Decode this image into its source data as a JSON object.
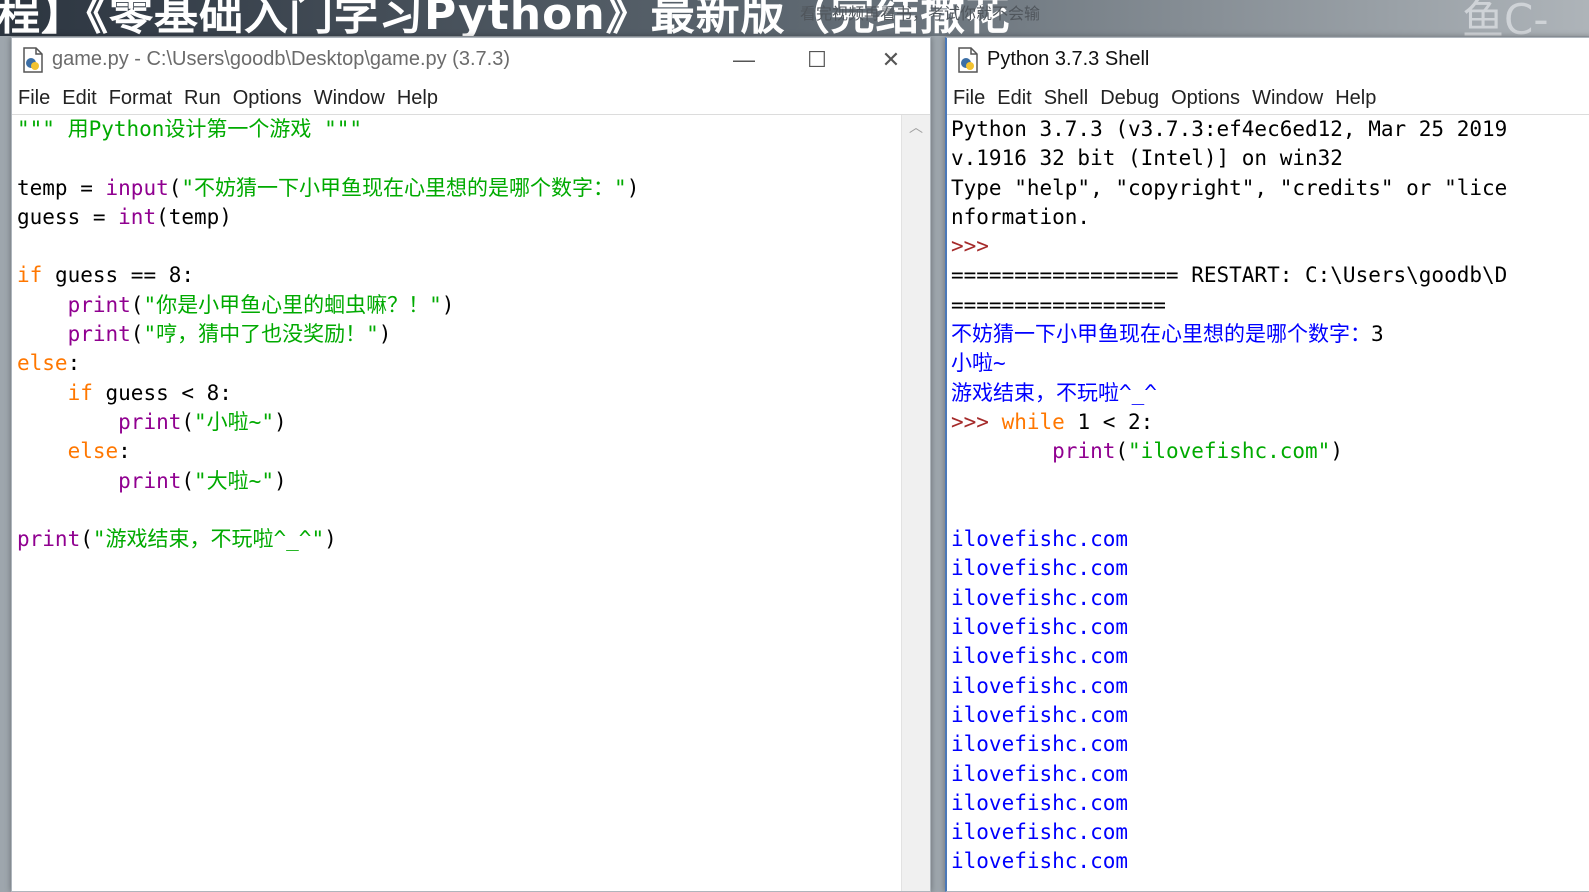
{
  "background": {
    "banner_text": "程】《零基础入门学习Python》最新版（完结撒花",
    "banner_subtitle": "看完视频再看书，考试你就不会输",
    "banner_logo": "鱼C-"
  },
  "editor": {
    "title": "game.py - C:\\Users\\goodb\\Desktop\\game.py (3.7.3)",
    "menu": [
      "File",
      "Edit",
      "Format",
      "Run",
      "Options",
      "Window",
      "Help"
    ],
    "lines": [
      [
        {
          "t": "\"\"\" 用Python设计第一个游戏 \"\"\"",
          "c": "str"
        }
      ],
      [],
      [
        {
          "t": "temp = ",
          "c": "def"
        },
        {
          "t": "input",
          "c": "bi"
        },
        {
          "t": "(",
          "c": "def"
        },
        {
          "t": "\"不妨猜一下小甲鱼现在心里想的是哪个数字：\"",
          "c": "str"
        },
        {
          "t": ")",
          "c": "def"
        }
      ],
      [
        {
          "t": "guess = ",
          "c": "def"
        },
        {
          "t": "int",
          "c": "bi"
        },
        {
          "t": "(temp)",
          "c": "def"
        }
      ],
      [],
      [
        {
          "t": "if",
          "c": "kw"
        },
        {
          "t": " guess == 8:",
          "c": "def"
        }
      ],
      [
        {
          "t": "    ",
          "c": "def"
        },
        {
          "t": "print",
          "c": "bi"
        },
        {
          "t": "(",
          "c": "def"
        },
        {
          "t": "\"你是小甲鱼心里的蛔虫嘛？！\"",
          "c": "str"
        },
        {
          "t": ")",
          "c": "def"
        }
      ],
      [
        {
          "t": "    ",
          "c": "def"
        },
        {
          "t": "print",
          "c": "bi"
        },
        {
          "t": "(",
          "c": "def"
        },
        {
          "t": "\"哼，猜中了也没奖励！\"",
          "c": "str"
        },
        {
          "t": ")",
          "c": "def"
        }
      ],
      [
        {
          "t": "else",
          "c": "kw"
        },
        {
          "t": ":",
          "c": "def"
        }
      ],
      [
        {
          "t": "    ",
          "c": "def"
        },
        {
          "t": "if",
          "c": "kw"
        },
        {
          "t": " guess < 8:",
          "c": "def"
        }
      ],
      [
        {
          "t": "        ",
          "c": "def"
        },
        {
          "t": "print",
          "c": "bi"
        },
        {
          "t": "(",
          "c": "def"
        },
        {
          "t": "\"小啦~\"",
          "c": "str"
        },
        {
          "t": ")",
          "c": "def"
        }
      ],
      [
        {
          "t": "    ",
          "c": "def"
        },
        {
          "t": "else",
          "c": "kw"
        },
        {
          "t": ":",
          "c": "def"
        }
      ],
      [
        {
          "t": "        ",
          "c": "def"
        },
        {
          "t": "print",
          "c": "bi"
        },
        {
          "t": "(",
          "c": "def"
        },
        {
          "t": "\"大啦~\"",
          "c": "str"
        },
        {
          "t": ")",
          "c": "def"
        }
      ],
      [],
      [
        {
          "t": "print",
          "c": "bi"
        },
        {
          "t": "(",
          "c": "def"
        },
        {
          "t": "\"游戏结束，不玩啦^_^\"",
          "c": "str"
        },
        {
          "t": ")",
          "c": "def"
        }
      ]
    ]
  },
  "shell": {
    "title": "Python 3.7.3 Shell",
    "menu": [
      "File",
      "Edit",
      "Shell",
      "Debug",
      "Options",
      "Window",
      "Help"
    ],
    "lines": [
      [
        {
          "t": "Python 3.7.3 (v3.7.3:ef4ec6ed12, Mar 25 2019",
          "c": "def"
        }
      ],
      [
        {
          "t": "v.1916 32 bit (Intel)] on win32",
          "c": "def"
        }
      ],
      [
        {
          "t": "Type \"help\", \"copyright\", \"credits\" or \"lice",
          "c": "def"
        }
      ],
      [
        {
          "t": "nformation.",
          "c": "def"
        }
      ],
      [
        {
          "t": ">>> ",
          "c": "prompt"
        }
      ],
      [
        {
          "t": "================== RESTART: C:\\Users\\goodb\\D",
          "c": "def"
        }
      ],
      [
        {
          "t": "=================",
          "c": "def"
        }
      ],
      [
        {
          "t": "不妨猜一下小甲鱼现在心里想的是哪个数字：",
          "c": "out"
        },
        {
          "t": "3",
          "c": "def"
        }
      ],
      [
        {
          "t": "小啦~",
          "c": "out"
        }
      ],
      [
        {
          "t": "游戏结束，不玩啦^_^",
          "c": "out"
        }
      ],
      [
        {
          "t": ">>> ",
          "c": "prompt"
        },
        {
          "t": "while",
          "c": "kw"
        },
        {
          "t": " 1 < 2:",
          "c": "def"
        }
      ],
      [
        {
          "t": "        ",
          "c": "def"
        },
        {
          "t": "print",
          "c": "bi"
        },
        {
          "t": "(",
          "c": "def"
        },
        {
          "t": "\"ilovefishc.com\"",
          "c": "str"
        },
        {
          "t": ")",
          "c": "def"
        }
      ],
      [],
      [],
      [
        {
          "t": "ilovefishc.com",
          "c": "out"
        }
      ],
      [
        {
          "t": "ilovefishc.com",
          "c": "out"
        }
      ],
      [
        {
          "t": "ilovefishc.com",
          "c": "out"
        }
      ],
      [
        {
          "t": "ilovefishc.com",
          "c": "out"
        }
      ],
      [
        {
          "t": "ilovefishc.com",
          "c": "out"
        }
      ],
      [
        {
          "t": "ilovefishc.com",
          "c": "out"
        }
      ],
      [
        {
          "t": "ilovefishc.com",
          "c": "out"
        }
      ],
      [
        {
          "t": "ilovefishc.com",
          "c": "out"
        }
      ],
      [
        {
          "t": "ilovefishc.com",
          "c": "out"
        }
      ],
      [
        {
          "t": "ilovefishc.com",
          "c": "out"
        }
      ],
      [
        {
          "t": "ilovefishc.com",
          "c": "out"
        }
      ],
      [
        {
          "t": "ilovefishc.com",
          "c": "out"
        }
      ]
    ]
  },
  "window_controls": {
    "minimize_glyph": "—",
    "maximize_glyph": "☐",
    "close_glyph": "✕"
  },
  "colors": {
    "keyword": "#ff7700",
    "builtin": "#900090",
    "string": "#00aa00",
    "output": "#0000ff",
    "prompt": "#a52a2a"
  }
}
